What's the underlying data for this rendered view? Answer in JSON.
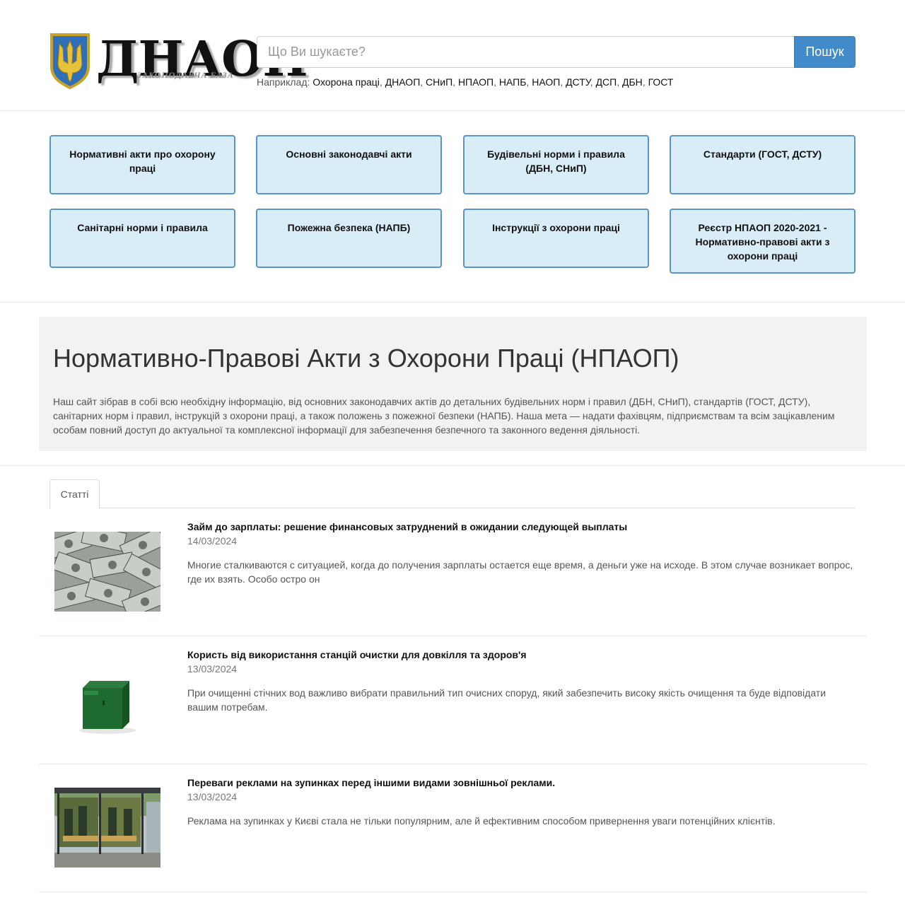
{
  "logo": {
    "name": "ДНАОП",
    "subtitle": "ЗАКОНОДАВЧА БАЗА"
  },
  "search": {
    "placeholder": "Що Ви шукаєте?",
    "button": "Пошук",
    "examples_label": "Наприклад:",
    "examples": [
      "Охорона праці",
      "ДНАОП",
      "СНиП",
      "НПАОП",
      "НАПБ",
      "НАОП",
      "ДСТУ",
      "ДСП",
      "ДБН",
      "ГОСТ"
    ]
  },
  "categories": [
    "Нормативні акти про охорону праці",
    "Основні законодавчі акти",
    "Будівельні норми і правила (ДБН, СНиП)",
    "Стандарти (ГОСТ, ДСТУ)",
    "Санітарні норми і правила",
    "Пожежна безпека (НАПБ)",
    "Інструкції з охорони праці",
    "Реєстр НПАОП 2020-2021 - Нормативно-правові акти з охорони праці"
  ],
  "intro": {
    "title": "Нормативно-Правові Акти з Охорони Праці (НПАОП)",
    "text": "Наш сайт зібрав в собі всю необхідну інформацію, від основних законодавчих актів до детальних будівельних норм і правил (ДБН, СНиП), стандартів (ГОСТ, ДСТУ), санітарних норм і правил, інструкцій з охорони праці, а також положень з пожежної безпеки (НАПБ). Наша мета — надати фахівцям, підприємствам та всім зацікавленим особам повний доступ до актуальної та комплексної інформації для забезпечення безпечного та законного ведення діяльності."
  },
  "tabs": {
    "articles": "Статті"
  },
  "articles": [
    {
      "title": "Займ до зарплаты: решение финансовых затруднений в ожидании следующей выплаты",
      "date": "14/03/2024",
      "text": "Многие сталкиваются с ситуацией, когда до получения зарплаты остается еще время, а деньги уже на исходе. В этом случае возникает вопрос, где их взять. Особо остро он",
      "thumb_icon": "money-image"
    },
    {
      "title": "Користь від використання станцій очистки для довкілля та здоров'я",
      "date": "13/03/2024",
      "text": "При очищенні стічних вод важливо вибрати правильний тип очисних споруд, який забезпечить високу якість очищення та буде відповідати вашим потребам.",
      "thumb_icon": "treatment-station-image"
    },
    {
      "title": "Переваги реклами на зупинках перед іншими видами зовнішньої реклами.",
      "date": "13/03/2024",
      "text": "Реклама на зупинках у Києві стала не тільки популярним, але й ефективним способом привернення уваги потенційних клієнтів.",
      "thumb_icon": "bus-stop-image"
    }
  ],
  "colors": {
    "accent": "#428bca",
    "category_bg": "#d9edf7",
    "category_border": "#5b94c9",
    "intro_bg": "#f2f2f2"
  }
}
